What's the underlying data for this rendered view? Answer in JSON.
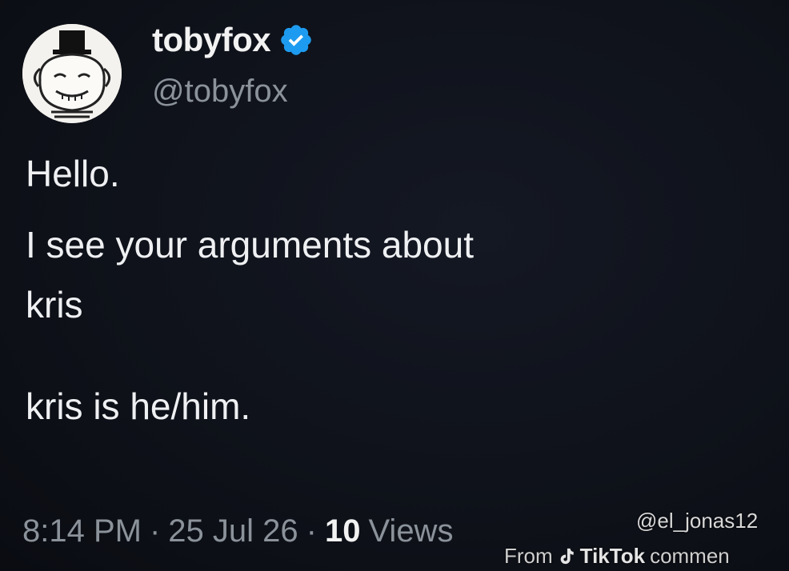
{
  "author": {
    "display_name": "tobyfox",
    "handle": "@tobyfox",
    "avatar_icon": "avatar-icon",
    "verified_icon": "verified-badge-icon",
    "verified_color": "#1d9bf0"
  },
  "tweet": {
    "lines": [
      "Hello.",
      "I see your arguments about",
      "kris",
      "kris is he/him."
    ]
  },
  "meta": {
    "time": "8:14 PM",
    "separator": "·",
    "date": "25 Jul 26",
    "views_count": "10",
    "views_label": "Views"
  },
  "watermark": {
    "username": "@el_jonas12",
    "from_text": "From",
    "platform": "TikTok",
    "trailing_text": "commen",
    "tiktok_icon": "tiktok-logo-icon"
  },
  "colors": {
    "background": "#0e1119",
    "primary_text": "#e7e9ea",
    "secondary_text": "#8b929a"
  }
}
